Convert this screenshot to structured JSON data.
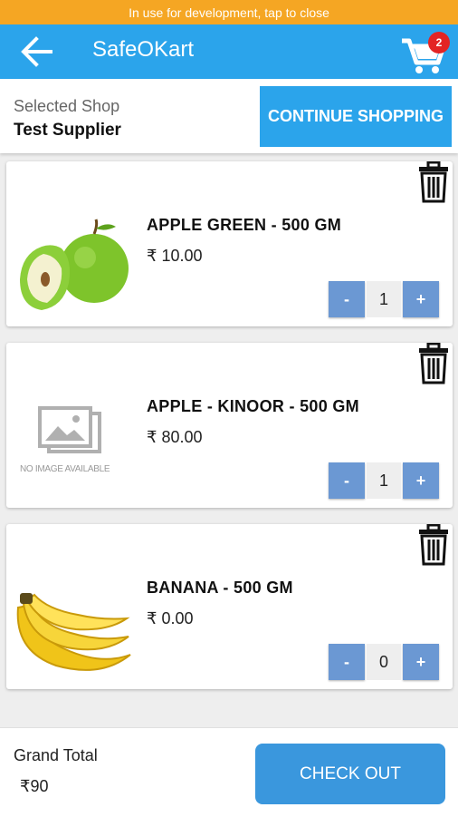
{
  "dev_banner": {
    "text": "In use for development, tap to close"
  },
  "app_bar": {
    "title": "SafeOKart",
    "cart_count": "2",
    "back_icon": "arrow-left-icon",
    "cart_icon": "cart-icon"
  },
  "shop": {
    "label": "Selected Shop",
    "name": "Test Supplier",
    "continue_label": "CONTINUE SHOPPING"
  },
  "items": [
    {
      "name": "APPLE GREEN - 500 GM",
      "price": "₹ 10.00",
      "quantity": "1",
      "minus": "-",
      "plus": "+",
      "image": "green-apple-image"
    },
    {
      "name": "APPLE - KINOOR - 500 GM",
      "price": "₹ 80.00",
      "quantity": "1",
      "minus": "-",
      "plus": "+",
      "image": "no-image-placeholder",
      "no_image_text": "NO IMAGE AVAILABLE"
    },
    {
      "name": "BANANA - 500 GM",
      "price": "₹ 0.00",
      "quantity": "0",
      "minus": "-",
      "plus": "+",
      "image": "banana-image"
    }
  ],
  "footer": {
    "grand_total_label": "Grand Total",
    "grand_total_value": "₹90",
    "checkout_label": "CHECK OUT"
  },
  "colors": {
    "primary": "#2ba4eb",
    "banner": "#f5a623",
    "qty_button": "#6b98d3",
    "badge": "#e32424",
    "checkout": "#3a97dd"
  }
}
